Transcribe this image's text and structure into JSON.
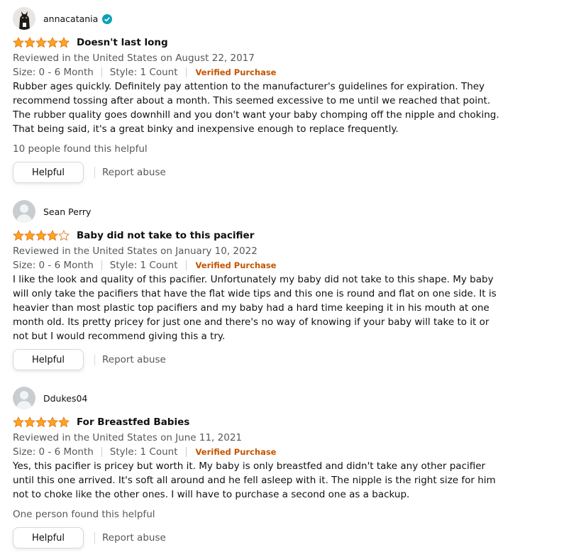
{
  "colors": {
    "star": "#ffa41c",
    "verified": "#c45500",
    "meta_text": "#565959",
    "badge": "#0aa2b7"
  },
  "labels": {
    "helpful_button": "Helpful",
    "report_abuse": "Report abuse",
    "verified_purchase": "Verified Purchase"
  },
  "reviews": [
    {
      "author": "annacatania",
      "author_badge_icon": "verified-check-icon",
      "avatar_icon": "cat-avatar-icon",
      "rating": 5,
      "title": "Doesn't last long",
      "reviewed": "Reviewed in the United States on August 22, 2017",
      "size": "Size: 0 - 6 Month",
      "style": "Style: 1 Count",
      "body": "Rubber ages quickly. Definitely pay attention to the manufacturer's guidelines for expiration. They recommend tossing after about a month. This seemed excessive to me until we reached that point. The rubber quality goes downhill and you don't want your baby chomping off the nipple and choking. That being said, it's a great binky and inexpensive enough to replace frequently.",
      "helpful_count": "10 people found this helpful"
    },
    {
      "author": "Sean Perry",
      "avatar_icon": "default-user-icon",
      "rating": 4,
      "title": "Baby did not take to this pacifier",
      "reviewed": "Reviewed in the United States on January 10, 2022",
      "size": "Size: 0 - 6 Month",
      "style": "Style: 1 Count",
      "body": "I like the look and quality of this pacifier. Unfortunately my baby did not take to this shape. My baby will only take the pacifiers that have the flat wide tips and this one is round and flat on one side. It is heavier than most plastic top pacifiers and my baby had a hard time keeping it in his mouth at one month old. Its pretty pricey for just one and there's no way of knowing if your baby will take to it or not but I would recommend giving this a try.",
      "helpful_count": ""
    },
    {
      "author": "Ddukes04",
      "avatar_icon": "default-user-icon",
      "rating": 5,
      "title": "For Breastfed Babies",
      "reviewed": "Reviewed in the United States on June 11, 2021",
      "size": "Size: 0 - 6 Month",
      "style": "Style: 1 Count",
      "body": "Yes, this pacifier is pricey but worth it. My baby is only breastfed and didn't take any other pacifier until this one arrived. It's soft all around and he fell asleep with it. The nipple is the right size for him not to choke like the other ones. I will have to purchase a second one as a backup.",
      "helpful_count": "One person found this helpful"
    }
  ]
}
